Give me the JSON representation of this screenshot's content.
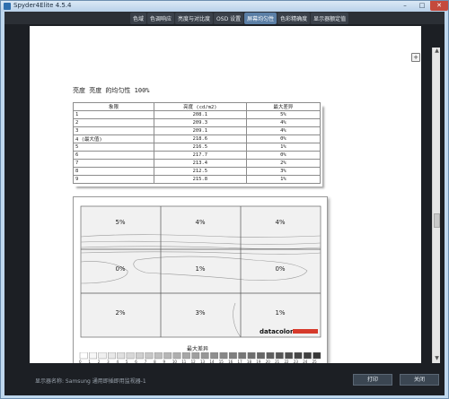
{
  "app": {
    "title": "Spyder4Elite 4.5.4"
  },
  "tabs": [
    {
      "label": "色域"
    },
    {
      "label": "色调响应"
    },
    {
      "label": "亮度与对比度"
    },
    {
      "label": "OSD 设置"
    },
    {
      "label": "屏幕均匀性"
    },
    {
      "label": "色彩精确度"
    },
    {
      "label": "显示器额定值"
    }
  ],
  "active_tab": "屏幕均匀性",
  "report": {
    "section_title": "亮度 亮度 的均匀性 100%",
    "table": {
      "headers": [
        "象限",
        "亮度 (cd/m2)",
        "最大差异"
      ],
      "rows": [
        [
          "1",
          "208.1",
          "5%"
        ],
        [
          "2",
          "209.3",
          "4%"
        ],
        [
          "3",
          "209.1",
          "4%"
        ],
        [
          "4 (最大值)",
          "218.6",
          "0%"
        ],
        [
          "5",
          "216.5",
          "1%"
        ],
        [
          "6",
          "217.7",
          "0%"
        ],
        [
          "7",
          "213.4",
          "2%"
        ],
        [
          "8",
          "212.5",
          "3%"
        ],
        [
          "9",
          "215.8",
          "1%"
        ]
      ]
    },
    "grid_cells": [
      "5%",
      "4%",
      "4%",
      "0%",
      "1%",
      "0%",
      "2%",
      "3%",
      "1%"
    ],
    "brand": "datacolor",
    "legend_title": "最大差异",
    "legend_scale": [
      "0",
      "1",
      "2",
      "3",
      "4",
      "5",
      "6",
      "7",
      "8",
      "9",
      "10",
      "11",
      "12",
      "13",
      "14",
      "15",
      "16",
      "17",
      "18",
      "19",
      "20",
      "21",
      "22",
      "23",
      "24",
      "25"
    ]
  },
  "footer": {
    "monitor_label": "显示器名称: Samsung 通用即插即用监视器-1",
    "print_label": "打印",
    "close_label": "关闭"
  },
  "icons": [
    "zoom-in-icon",
    "zoom-out-icon",
    "zoom-fit-icon"
  ]
}
